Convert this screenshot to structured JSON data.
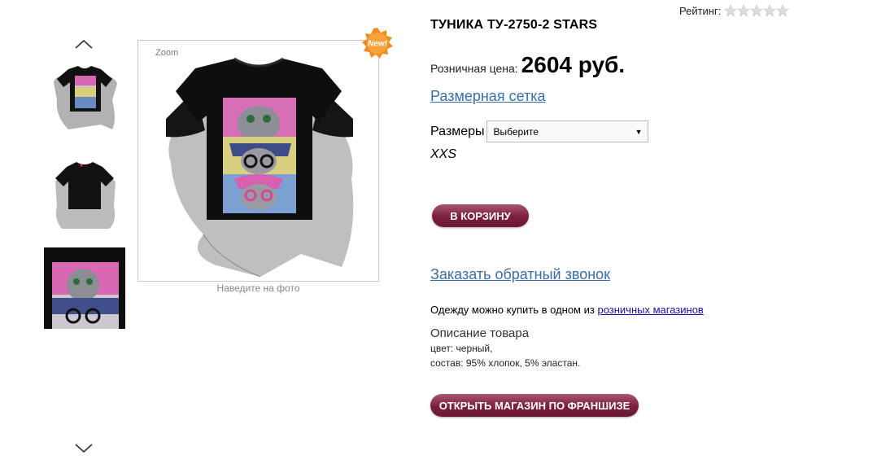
{
  "gallery": {
    "zoom_label": "Zoom",
    "hover_hint": "Наведите на фото",
    "badge_text": "New!"
  },
  "product": {
    "rating_label": "Рейтинг:",
    "rating_value": 0,
    "rating_max": 5,
    "title": "ТУНИКА ТУ-2750-2 STARS",
    "price_label": "Розничная цена:",
    "price_value": "2604 руб.",
    "size_table_link": "Размерная сетка",
    "sizes_label": "Размеры",
    "sizes_select_value": "Выберите",
    "size_option": "XXS",
    "cart_button": "В КОРЗИНУ",
    "callback_link": "Заказать обратный звонок",
    "buy_text": "Одежду можно купить в одном из",
    "buy_link": "розничных магазинов",
    "desc_heading": "Описание товара",
    "desc_color": "цвет: черный,",
    "desc_composition": "состав: 95% хлопок, 5% эластан.",
    "franchise_button": "ОТКРЫТЬ МАГАЗИН ПО ФРАНШИЗЕ"
  },
  "colors": {
    "link": "#3a6ea8",
    "button": "#7a1f3d",
    "badge": "#f28c1c"
  }
}
